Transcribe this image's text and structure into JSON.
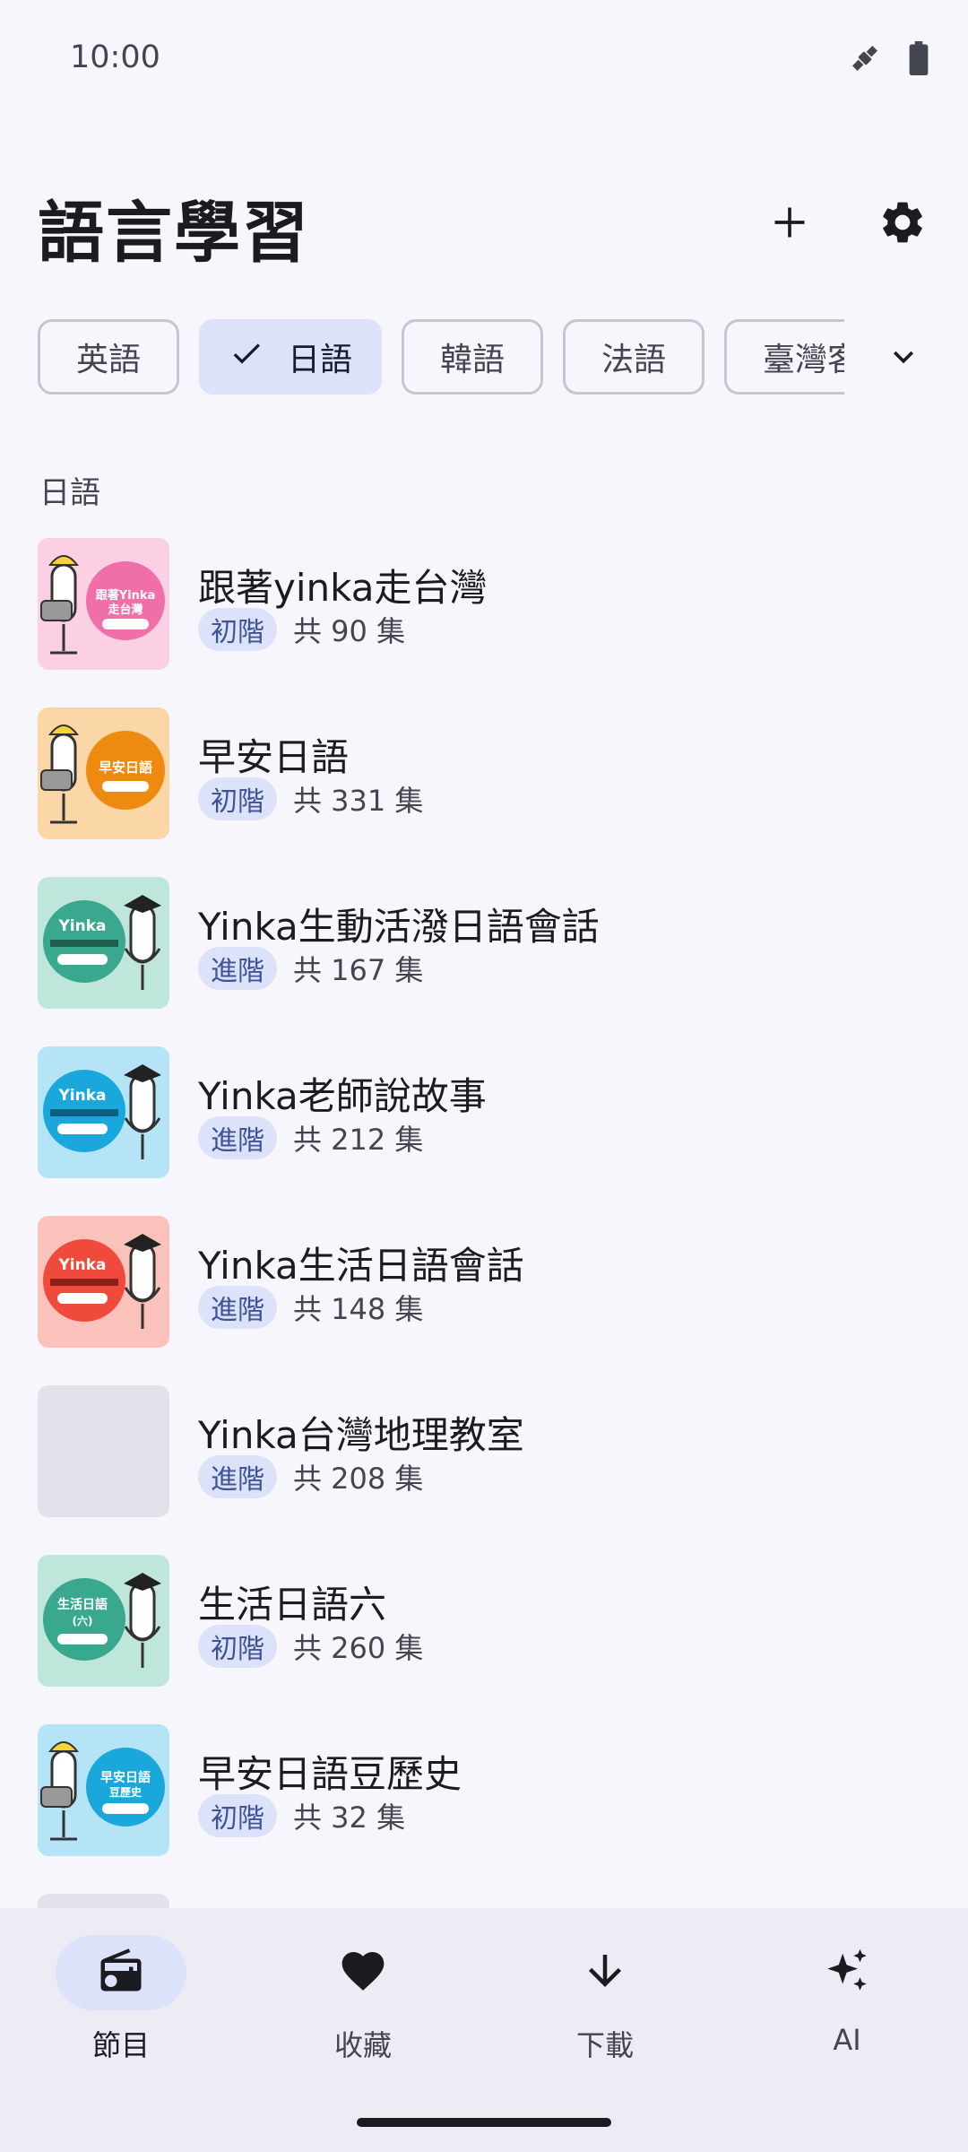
{
  "status_bar": {
    "time": "10:00",
    "icons": [
      "satellite-icon",
      "battery-icon"
    ]
  },
  "header": {
    "title": "語言學習",
    "add_icon": "plus-icon",
    "settings_icon": "gear-icon"
  },
  "language_chips": [
    {
      "label": "英語",
      "selected": false
    },
    {
      "label": "日語",
      "selected": true
    },
    {
      "label": "韓語",
      "selected": false
    },
    {
      "label": "法語",
      "selected": false
    },
    {
      "label": "臺灣客",
      "selected": false
    }
  ],
  "section": {
    "title": "日語"
  },
  "programs": [
    {
      "title": "跟著yinka走台灣",
      "level": "初階",
      "count": "共 90 集",
      "thumb_color": "#f06fa8",
      "thumb_text": "跟著Yinka走台灣"
    },
    {
      "title": "早安日語",
      "level": "初階",
      "count": "共 331 集",
      "thumb_color": "#ee8a10",
      "thumb_text": "早安日語"
    },
    {
      "title": "Yinka生動活潑日語會話",
      "level": "進階",
      "count": "共 167 集",
      "thumb_color": "#3aa88e",
      "thumb_text": "Yinka"
    },
    {
      "title": "Yinka老師說故事",
      "level": "進階",
      "count": "共 212 集",
      "thumb_color": "#1aa8dc",
      "thumb_text": "Yinka"
    },
    {
      "title": "Yinka生活日語會話",
      "level": "進階",
      "count": "共 148 集",
      "thumb_color": "#ef4a3c",
      "thumb_text": "Yinka"
    },
    {
      "title": "Yinka台灣地理教室",
      "level": "進階",
      "count": "共 208 集",
      "thumb_color": "",
      "thumb_text": ""
    },
    {
      "title": "生活日語六",
      "level": "初階",
      "count": "共 260 集",
      "thumb_color": "#3aa88e",
      "thumb_text": "生活日語"
    },
    {
      "title": "早安日語豆歷史",
      "level": "初階",
      "count": "共 32 集",
      "thumb_color": "#1aa8dc",
      "thumb_text": "早安日語"
    }
  ],
  "bottom_nav": [
    {
      "label": "節目",
      "icon": "radio-icon",
      "active": true
    },
    {
      "label": "收藏",
      "icon": "heart-icon",
      "active": false
    },
    {
      "label": "下載",
      "icon": "download-arrow-icon",
      "active": false
    },
    {
      "label": "AI",
      "icon": "sparkles-icon",
      "active": false
    }
  ],
  "colors": {
    "background": "#f8f6fd",
    "chip_selected": "#dce2f9",
    "badge_text": "#3f5498",
    "nav_background": "#edebf3"
  }
}
